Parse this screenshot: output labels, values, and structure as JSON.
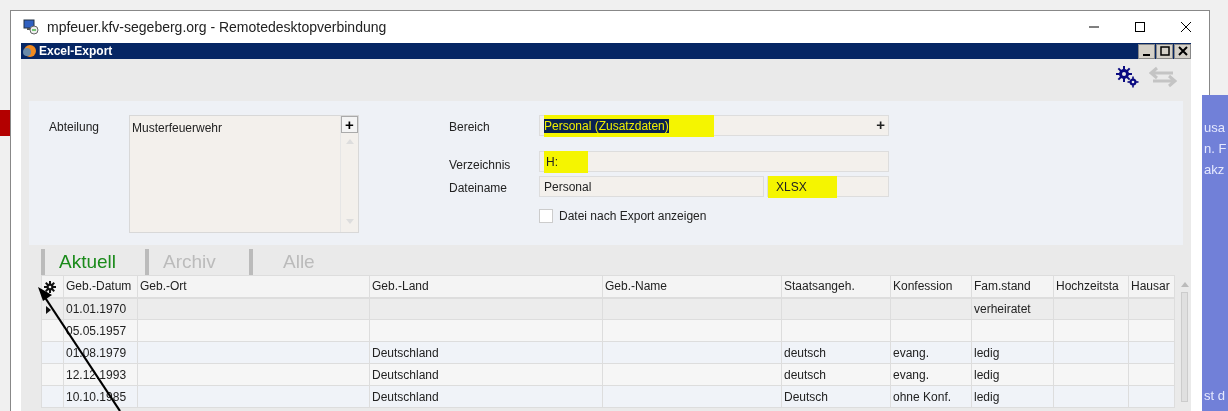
{
  "rdp_window": {
    "title": "mpfeuer.kfv-segeberg.org - Remotedesktopverbindung"
  },
  "app_window": {
    "title": "Excel-Export"
  },
  "form": {
    "abteilung": {
      "label": "Abteilung",
      "items": [
        "Musterfeuerwehr"
      ],
      "add_button": "+"
    },
    "bereich": {
      "label": "Bereich",
      "value": "Personal (Zusatzdaten)",
      "text_selected": true,
      "highlighted": true,
      "add_button": "+"
    },
    "verzeichnis": {
      "label": "Verzeichnis",
      "value": "H:",
      "highlighted": true
    },
    "dateiname": {
      "label": "Dateiname",
      "value": "Personal",
      "extension": "XLSX",
      "extension_highlighted": true
    },
    "show_file": {
      "label": "Datei nach Export anzeigen",
      "checked": false
    }
  },
  "tabs": [
    {
      "label": "Aktuell",
      "selected": true
    },
    {
      "label": "Archiv",
      "selected": false
    },
    {
      "label": "Alle",
      "selected": false
    }
  ],
  "table": {
    "columns": [
      "Geb.-Datum",
      "Geb.-Ort",
      "Geb.-Land",
      "Geb.-Name",
      "Staatsangeh.",
      "Konfession",
      "Fam.stand",
      "Hochzeitsta",
      "Hausar"
    ],
    "rows": [
      {
        "selected": true,
        "cells": [
          "01.01.1970",
          null,
          null,
          null,
          null,
          null,
          "verheiratet",
          null,
          null
        ]
      },
      {
        "selected": false,
        "cells": [
          "05.05.1957",
          null,
          null,
          null,
          null,
          null,
          null,
          null,
          null
        ]
      },
      {
        "selected": false,
        "cells": [
          "01.08.1979",
          null,
          "Deutschland",
          null,
          "deutsch",
          "evang.",
          "ledig",
          null,
          null
        ]
      },
      {
        "selected": false,
        "cells": [
          "12.12.1993",
          null,
          "Deutschland",
          null,
          "deutsch",
          "evang.",
          "ledig",
          null,
          null
        ]
      },
      {
        "selected": false,
        "cells": [
          "10.10.1985",
          null,
          "Deutschland",
          null,
          "Deutsch",
          "ohne Konf.",
          "ledig",
          null,
          null
        ]
      }
    ]
  },
  "background_text": [
    "usa",
    "n. F",
    "akz",
    "st d"
  ]
}
